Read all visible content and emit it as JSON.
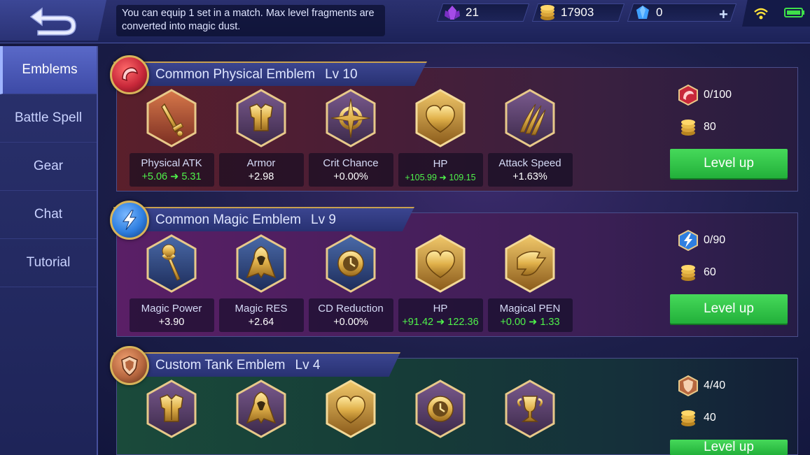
{
  "header": {
    "hint": "You can equip 1 set in a match. Max level fragments are converted into magic dust.",
    "currencies": [
      {
        "icon": "purple-crystal-icon",
        "value": "21"
      },
      {
        "icon": "gold-coins-icon",
        "value": "17903"
      },
      {
        "icon": "diamond-icon",
        "value": "0"
      }
    ]
  },
  "sidebar": {
    "items": [
      {
        "label": "Emblems",
        "active": true
      },
      {
        "label": "Battle Spell",
        "active": false
      },
      {
        "label": "Gear",
        "active": false
      },
      {
        "label": "Chat",
        "active": false
      },
      {
        "label": "Tutorial",
        "active": false
      }
    ]
  },
  "emblems": [
    {
      "name": "Common Physical Emblem",
      "level": "Lv 10",
      "type_icon": "physical-emblem-icon",
      "stats": [
        {
          "name": "Physical ATK",
          "value": "+5.06 ➜ 5.31",
          "icon": "sword-icon"
        },
        {
          "name": "Armor",
          "value": "+2.98",
          "icon": "armor-icon"
        },
        {
          "name": "Crit Chance",
          "value": "+0.00%",
          "icon": "crit-icon"
        },
        {
          "name": "HP",
          "value": "+105.99 ➜ 109.15",
          "icon": "heart-icon"
        },
        {
          "name": "Attack Speed",
          "value": "+1.63%",
          "icon": "claw-icon"
        }
      ],
      "fragments": "0/100",
      "cost": "80",
      "button": "Level up"
    },
    {
      "name": "Common Magic Emblem",
      "level": "Lv 9",
      "type_icon": "magic-emblem-icon",
      "stats": [
        {
          "name": "Magic Power",
          "value": "+3.90",
          "icon": "staff-icon"
        },
        {
          "name": "Magic RES",
          "value": "+2.64",
          "icon": "cloak-icon"
        },
        {
          "name": "CD Reduction",
          "value": "+0.00%",
          "icon": "cooldown-icon"
        },
        {
          "name": "HP",
          "value": "+91.42 ➜ 122.36",
          "icon": "heart-icon"
        },
        {
          "name": "Magical PEN",
          "value": "+0.00 ➜ 1.33",
          "icon": "magic-pen-icon"
        }
      ],
      "fragments": "0/90",
      "cost": "60",
      "button": "Level up"
    },
    {
      "name": "Custom Tank Emblem",
      "level": "Lv 4",
      "type_icon": "tank-emblem-icon",
      "stats": [
        {
          "icon": "armor-icon"
        },
        {
          "icon": "cloak-icon"
        },
        {
          "icon": "heart-icon"
        },
        {
          "icon": "cooldown-icon"
        },
        {
          "icon": "chalice-icon"
        }
      ],
      "fragments": "4/40",
      "cost": "40",
      "button": "Level up"
    }
  ],
  "colors": {
    "physical": "#c8283a",
    "magic": "#2f7fe0",
    "tank": "#b7673f",
    "level_up": "#2fc446",
    "stat_green": "#4ff24a",
    "gold": "#d8b45a"
  }
}
